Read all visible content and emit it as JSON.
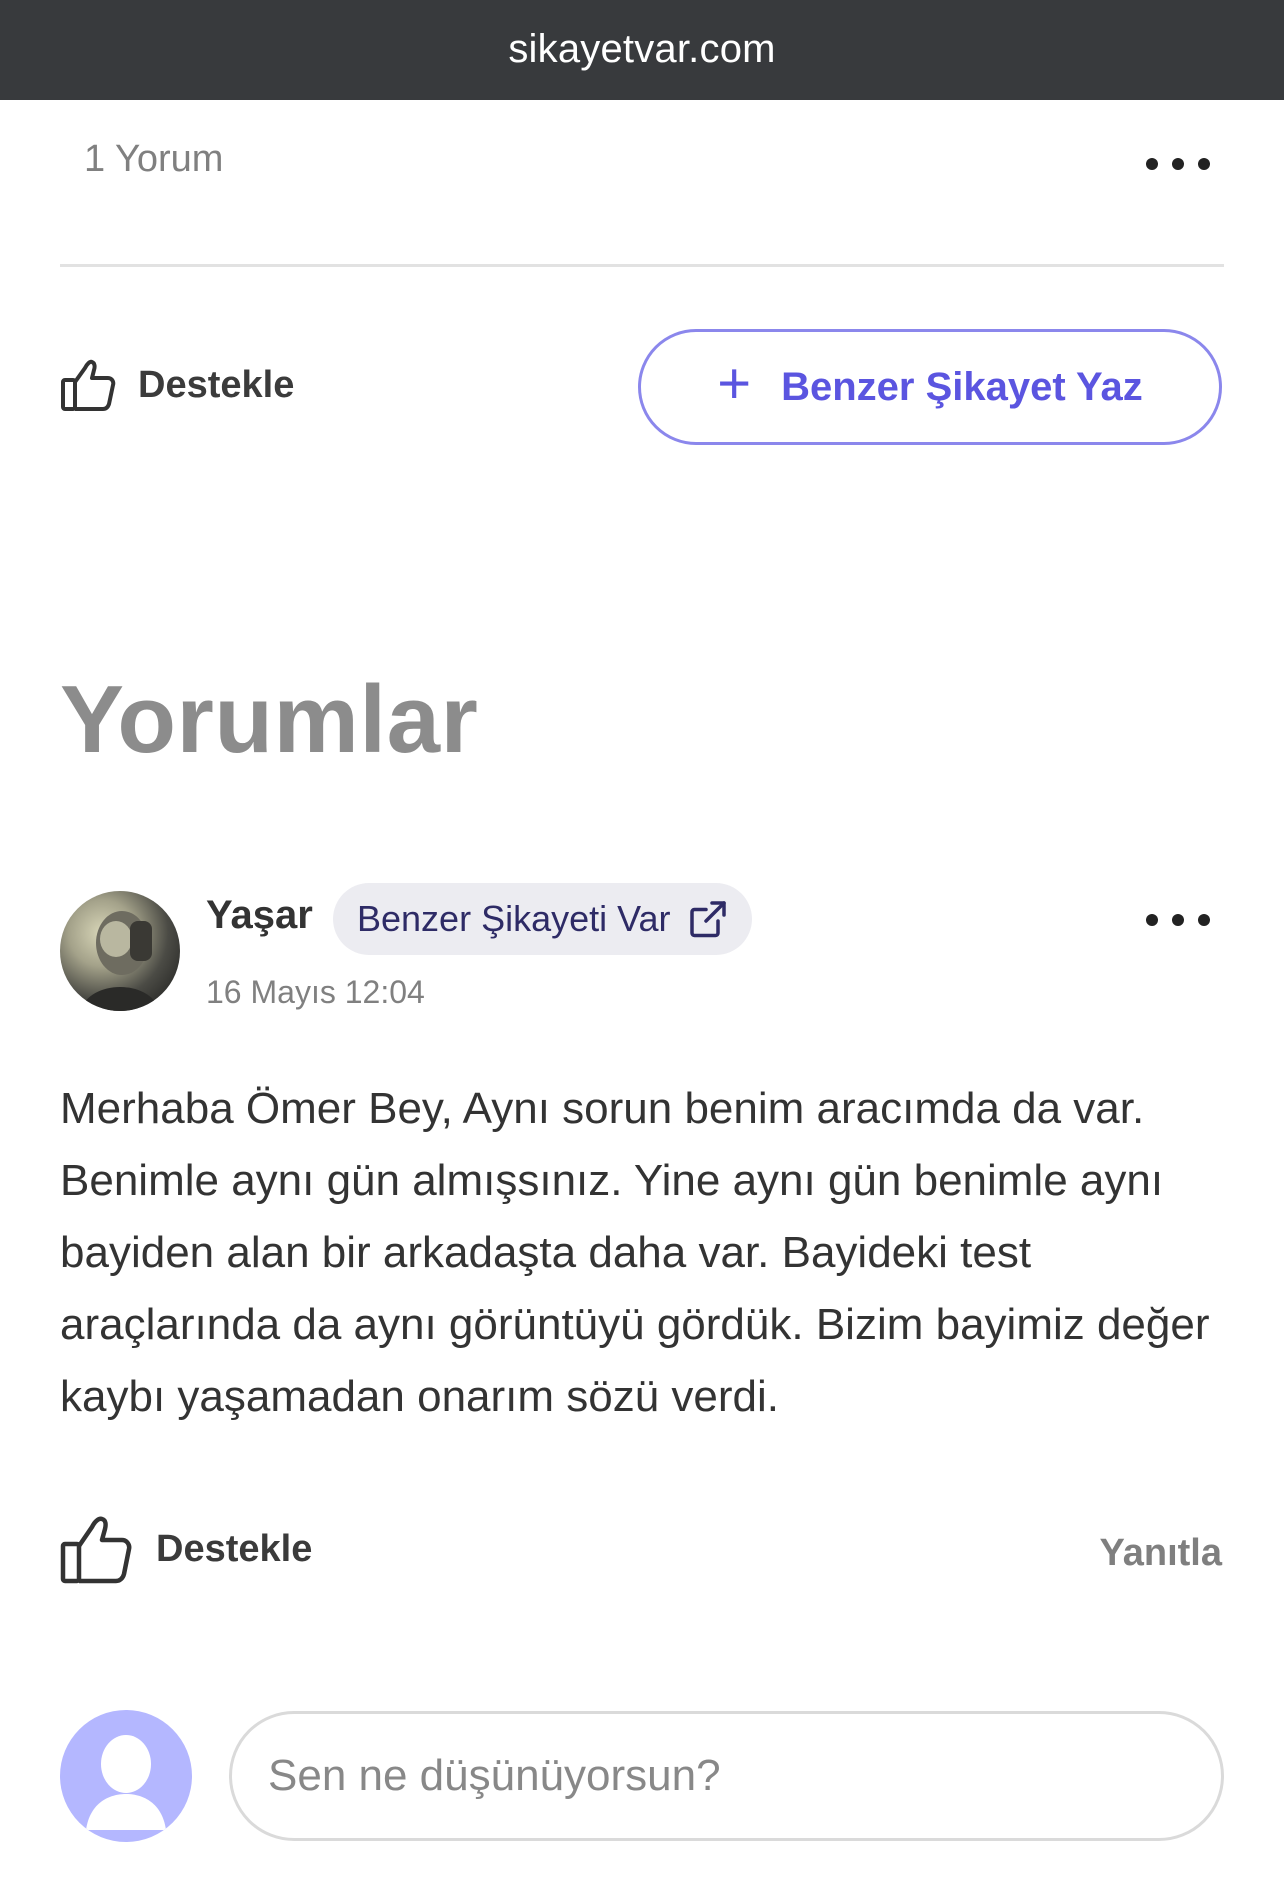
{
  "browser": {
    "url": "sikayetvar.com"
  },
  "complaint": {
    "comment_count_label": "1 Yorum",
    "support_label": "Destekle",
    "similar_complaint_button": "Benzer Şikayet Yaz"
  },
  "comments_section": {
    "title": "Yorumlar",
    "comments": [
      {
        "author": "Yaşar",
        "badge": "Benzer Şikayeti Var",
        "date": "16 Mayıs 12:04",
        "text": "Merhaba Ömer Bey, Aynı sorun benim aracımda da var. Benimle aynı gün almışsınız. Yine aynı gün benimle aynı bayiden alan bir arkadaşta daha var. Bayideki test araçlarında da aynı görüntüyü gördük. Bizim bayimiz değer kaybı yaşamadan onarım sözü verdi.",
        "support_label": "Destekle",
        "reply_label": "Yanıtla"
      }
    ]
  },
  "new_comment": {
    "placeholder": "Sen ne düşünüyorsun?"
  },
  "colors": {
    "accent": "#5b55e0",
    "accent_border": "#8b87ec",
    "topbar": "#383a3d",
    "user_avatar": "#b4b7ff"
  },
  "icons": {
    "support": "thumbs-up-icon",
    "add": "plus-icon",
    "external": "external-link-icon",
    "more": "more-dots-icon",
    "user": "user-placeholder-icon"
  }
}
